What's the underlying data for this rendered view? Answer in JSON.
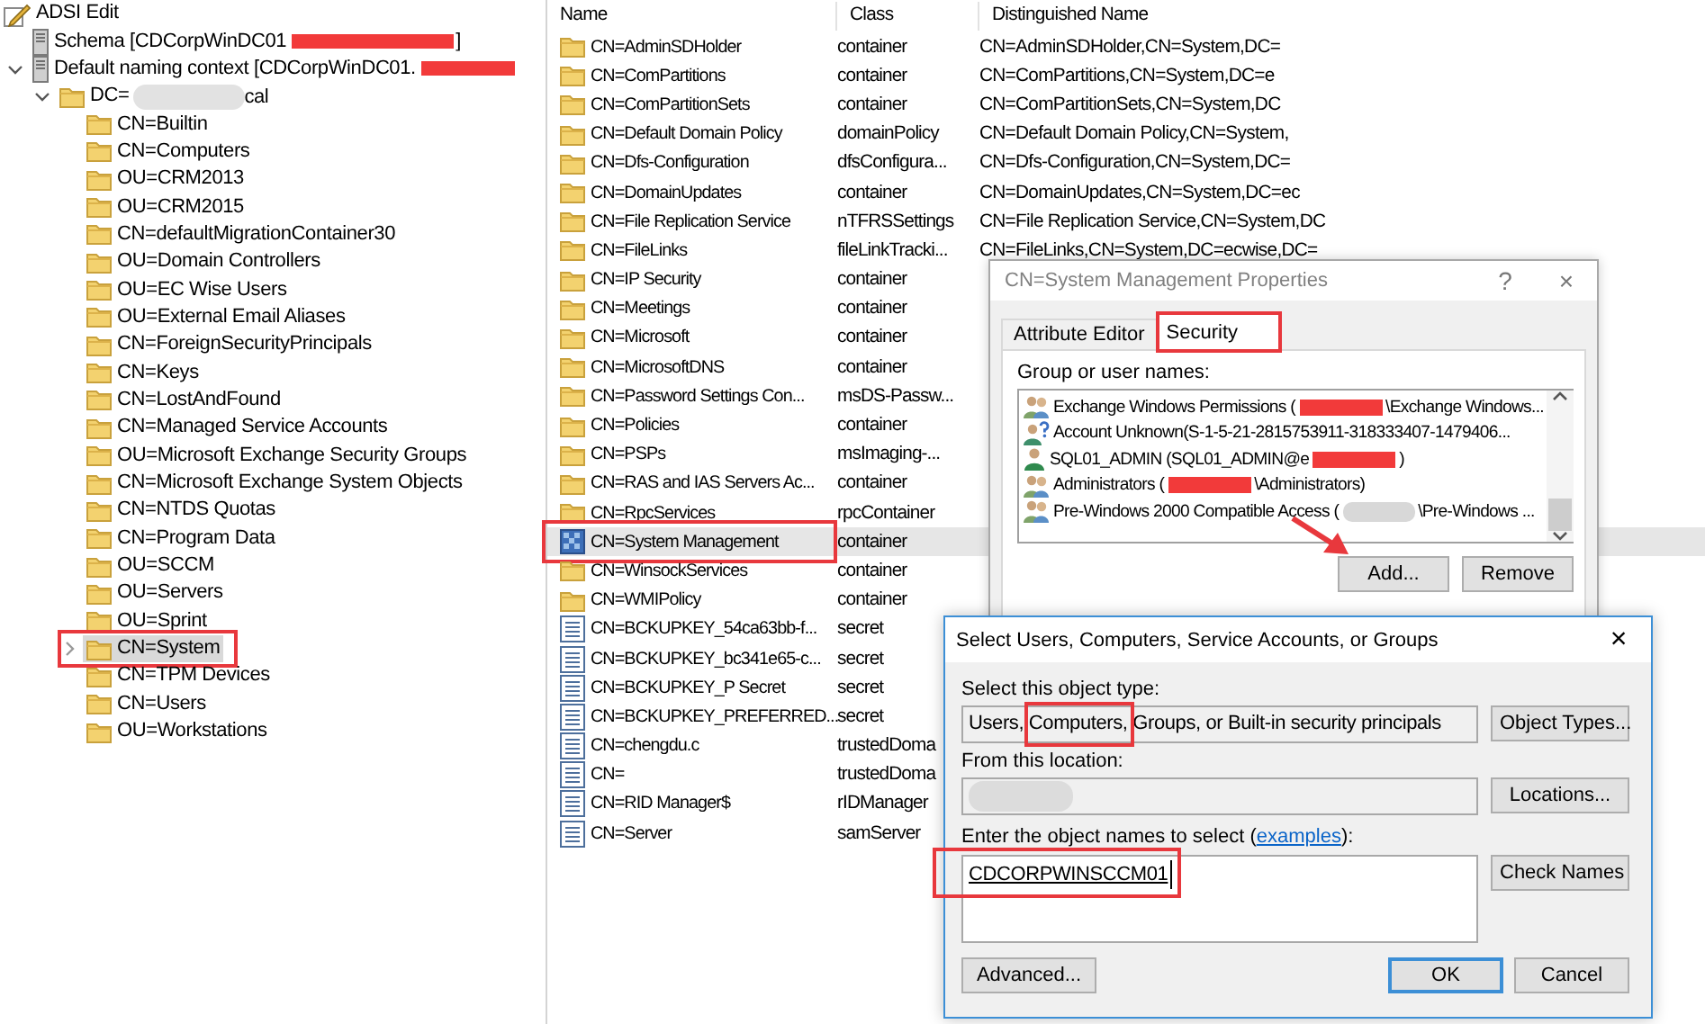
{
  "tree": {
    "items": [
      {
        "label": "ADSI Edit",
        "kind": "app",
        "selected": false,
        "highlighted": false,
        "children": [
          {
            "label": "Schema [CDCorpWinDC01",
            "redacted": true,
            "label_after": "]",
            "kind": "server",
            "selected": false,
            "highlighted": false
          },
          {
            "label": "Default naming context [CDCorpWinDC01.",
            "redacted": true,
            "kind": "server",
            "expanded": true,
            "selected": false,
            "highlighted": false,
            "children": [
              {
                "label": "DC=",
                "blurred": true,
                "label_after": "cal",
                "kind": "folder",
                "expanded": true,
                "selected": false,
                "highlighted": false,
                "children": [
                  {
                    "label": "CN=Builtin",
                    "kind": "folder",
                    "selected": false,
                    "highlighted": false
                  },
                  {
                    "label": "CN=Computers",
                    "kind": "folder",
                    "selected": false,
                    "highlighted": false
                  },
                  {
                    "label": "OU=CRM2013",
                    "kind": "folder",
                    "selected": false,
                    "highlighted": false
                  },
                  {
                    "label": "OU=CRM2015",
                    "kind": "folder",
                    "selected": false,
                    "highlighted": false
                  },
                  {
                    "label": "CN=defaultMigrationContainer30",
                    "kind": "folder",
                    "selected": false,
                    "highlighted": false
                  },
                  {
                    "label": "OU=Domain Controllers",
                    "kind": "folder",
                    "selected": false,
                    "highlighted": false
                  },
                  {
                    "label": "OU=EC Wise Users",
                    "kind": "folder",
                    "selected": false,
                    "highlighted": false
                  },
                  {
                    "label": "OU=External Email Aliases",
                    "kind": "folder",
                    "selected": false,
                    "highlighted": false
                  },
                  {
                    "label": "CN=ForeignSecurityPrincipals",
                    "kind": "folder",
                    "selected": false,
                    "highlighted": false
                  },
                  {
                    "label": "CN=Keys",
                    "kind": "folder",
                    "selected": false,
                    "highlighted": false
                  },
                  {
                    "label": "CN=LostAndFound",
                    "kind": "folder",
                    "selected": false,
                    "highlighted": false
                  },
                  {
                    "label": "CN=Managed Service Accounts",
                    "kind": "folder",
                    "selected": false,
                    "highlighted": false
                  },
                  {
                    "label": "OU=Microsoft Exchange Security Groups",
                    "kind": "folder",
                    "selected": false,
                    "highlighted": false
                  },
                  {
                    "label": "CN=Microsoft Exchange System Objects",
                    "kind": "folder",
                    "selected": false,
                    "highlighted": false
                  },
                  {
                    "label": "CN=NTDS Quotas",
                    "kind": "folder",
                    "selected": false,
                    "highlighted": false
                  },
                  {
                    "label": "CN=Program Data",
                    "kind": "folder",
                    "selected": false,
                    "highlighted": false
                  },
                  {
                    "label": "OU=SCCM",
                    "kind": "folder",
                    "selected": false,
                    "highlighted": false
                  },
                  {
                    "label": "OU=Servers",
                    "kind": "folder",
                    "selected": false,
                    "highlighted": false
                  },
                  {
                    "label": "OU=Sprint",
                    "kind": "folder",
                    "selected": false,
                    "highlighted": false
                  },
                  {
                    "label": "CN=System",
                    "kind": "folder",
                    "expanded": false,
                    "selected": true,
                    "highlighted": true
                  },
                  {
                    "label": "CN=TPM Devices",
                    "kind": "folder",
                    "selected": false,
                    "highlighted": false
                  },
                  {
                    "label": "CN=Users",
                    "kind": "folder",
                    "selected": false,
                    "highlighted": false
                  },
                  {
                    "label": "OU=Workstations",
                    "kind": "folder",
                    "selected": false,
                    "highlighted": false
                  }
                ]
              }
            ]
          }
        ]
      }
    ]
  },
  "list": {
    "columns": [
      "Name",
      "Class",
      "Distinguished Name"
    ],
    "rows": [
      {
        "name": "CN=AdminSDHolder",
        "class": "container",
        "dn": "CN=AdminSDHolder,CN=System,DC=",
        "kind": "folder",
        "selected": false,
        "highlighted": false
      },
      {
        "name": "CN=ComPartitions",
        "class": "container",
        "dn": "CN=ComPartitions,CN=System,DC=e",
        "kind": "folder",
        "selected": false,
        "highlighted": false
      },
      {
        "name": "CN=ComPartitionSets",
        "class": "container",
        "dn": "CN=ComPartitionSets,CN=System,DC",
        "kind": "folder",
        "selected": false,
        "highlighted": false
      },
      {
        "name": "CN=Default Domain Policy",
        "class": "domainPolicy",
        "dn": "CN=Default Domain Policy,CN=System,",
        "kind": "folder",
        "selected": false,
        "highlighted": false
      },
      {
        "name": "CN=Dfs-Configuration",
        "class": "dfsConfigura...",
        "dn": "CN=Dfs-Configuration,CN=System,DC=",
        "kind": "folder",
        "selected": false,
        "highlighted": false
      },
      {
        "name": "CN=DomainUpdates",
        "class": "container",
        "dn": "CN=DomainUpdates,CN=System,DC=ec",
        "kind": "folder",
        "selected": false,
        "highlighted": false
      },
      {
        "name": "CN=File Replication Service",
        "class": "nTFRSSettings",
        "dn": "CN=File Replication Service,CN=System,DC",
        "kind": "folder",
        "selected": false,
        "highlighted": false
      },
      {
        "name": "CN=FileLinks",
        "class": "fileLinkTracki...",
        "dn": "CN=FileLinks,CN=System,DC=ecwise,DC=",
        "kind": "folder",
        "selected": false,
        "highlighted": false
      },
      {
        "name": "CN=IP Security",
        "class": "container",
        "kind": "folder",
        "selected": false,
        "highlighted": false
      },
      {
        "name": "CN=Meetings",
        "class": "container",
        "kind": "folder",
        "selected": false,
        "highlighted": false
      },
      {
        "name": "CN=Microsoft",
        "class": "container",
        "kind": "folder",
        "selected": false,
        "highlighted": false
      },
      {
        "name": "CN=MicrosoftDNS",
        "class": "container",
        "kind": "folder",
        "selected": false,
        "highlighted": false
      },
      {
        "name": "CN=Password Settings Con...",
        "class": "msDS-Passw...",
        "kind": "folder",
        "selected": false,
        "highlighted": false
      },
      {
        "name": "CN=Policies",
        "class": "container",
        "kind": "folder",
        "selected": false,
        "highlighted": false
      },
      {
        "name": "CN=PSPs",
        "class": "msImaging-...",
        "kind": "folder",
        "selected": false,
        "highlighted": false
      },
      {
        "name": "CN=RAS and IAS Servers Ac...",
        "class": "container",
        "kind": "folder",
        "selected": false,
        "highlighted": false
      },
      {
        "name": "CN=RpcServices",
        "class": "rpcContainer",
        "kind": "folder",
        "selected": false,
        "highlighted": false
      },
      {
        "name": "CN=System Management",
        "class": "container",
        "kind": "policy",
        "selected": true,
        "highlighted": true
      },
      {
        "name": "CN=WinsockServices",
        "class": "container",
        "kind": "folder",
        "selected": false,
        "highlighted": false
      },
      {
        "name": "CN=WMIPolicy",
        "class": "container",
        "kind": "folder",
        "selected": false,
        "highlighted": false
      },
      {
        "name": "CN=BCKUPKEY_54ca63bb-f...",
        "class": "secret",
        "kind": "secret",
        "selected": false,
        "highlighted": false
      },
      {
        "name": "CN=BCKUPKEY_bc341e65-c...",
        "class": "secret",
        "kind": "secret",
        "selected": false,
        "highlighted": false
      },
      {
        "name": "CN=BCKUPKEY_P Secret",
        "class": "secret",
        "kind": "secret",
        "selected": false,
        "highlighted": false
      },
      {
        "name": "CN=BCKUPKEY_PREFERRED...",
        "class": "secret",
        "kind": "secret",
        "selected": false,
        "highlighted": false
      },
      {
        "name": "CN=chengdu.c",
        "class": "trustedDoma",
        "kind": "secret",
        "selected": false,
        "highlighted": false
      },
      {
        "name": "CN=",
        "class": "trustedDoma",
        "kind": "secret",
        "selected": false,
        "highlighted": false
      },
      {
        "name": "CN=RID Manager$",
        "class": "rIDManager",
        "kind": "secret",
        "selected": false,
        "highlighted": false
      },
      {
        "name": "CN=Server",
        "class": "samServer",
        "kind": "secret",
        "selected": false,
        "highlighted": false
      }
    ]
  },
  "properties_dialog": {
    "title": "CN=System Management Properties",
    "help": "?",
    "close": "×",
    "tabs": [
      {
        "label": "Attribute Editor",
        "selected": false,
        "highlighted": false
      },
      {
        "label": "Security",
        "selected": true,
        "highlighted": true
      }
    ],
    "group_label": "Group or user names:",
    "principals": [
      {
        "kind": "group",
        "name": "Exchange Windows Permissions (",
        "redacted": true,
        "name_after": "\\Exchange Windows..."
      },
      {
        "kind": "unknown",
        "name": "Account Unknown(S-1-5-21-2815753911-318333407-1479406..."
      },
      {
        "kind": "user",
        "name": "SQL01_ADMIN (SQL01_ADMIN@e",
        "redacted": true,
        "name_after": ")"
      },
      {
        "kind": "group",
        "name": "Administrators (",
        "redacted": true,
        "name_after": "\\Administrators)"
      },
      {
        "kind": "group",
        "name": "Pre-Windows 2000 Compatible Access (",
        "blurred": true,
        "name_after": "\\Pre-Windows ..."
      }
    ],
    "buttons": [
      "Add...",
      "Remove"
    ]
  },
  "select_dialog": {
    "title": "Select Users, Computers, Service Accounts, or Groups",
    "close": "×",
    "object_type_label": "Select this object type:",
    "object_type": "Users, Computers, Groups, or Built-in security principals",
    "object_type_highlighted": true,
    "object_types_button": "Object Types...",
    "location_label": "From this location:",
    "location_blurred": true,
    "locations_button": "Locations...",
    "names_label": "Enter the object names to select (",
    "names_link": "examples",
    "names_label_end": "):",
    "names_value": "CDCORPWINSCCM01",
    "names_highlighted": true,
    "check_names_button": "Check Names",
    "advanced_button": "Advanced...",
    "ok_button": "OK",
    "cancel_button": "Cancel"
  },
  "annotation_arrow": true
}
